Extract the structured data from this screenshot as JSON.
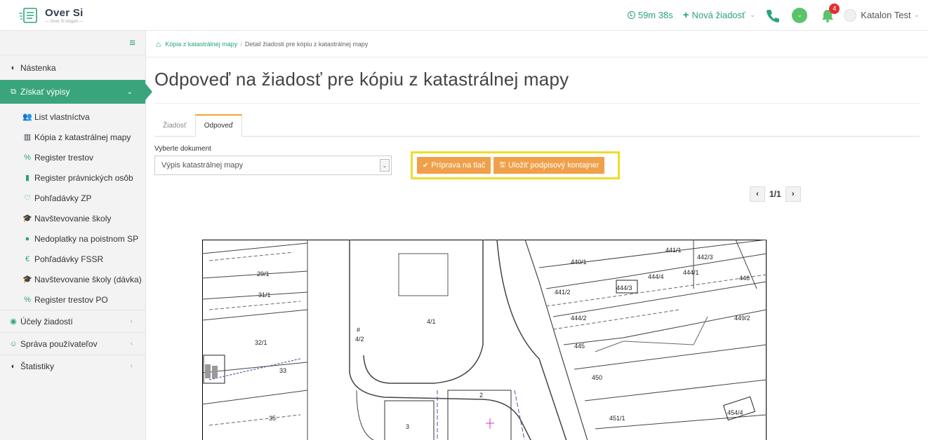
{
  "brand": {
    "name": "Over Si",
    "tagline": "— Over Si slogan —"
  },
  "topbar": {
    "timer": "59m 38s",
    "new_request": "Nová žiadosť",
    "notifications": "4",
    "user_name": "Katalon Test"
  },
  "sidebar": {
    "items": [
      {
        "label": "Nástenka",
        "icon": "dashboard-icon"
      },
      {
        "label": "Získať výpisy",
        "icon": "copy-icon",
        "active": true
      },
      {
        "label": "List vlastníctva",
        "icon": "users-icon"
      },
      {
        "label": "Kópia z katastrálnej mapy",
        "icon": "map-icon"
      },
      {
        "label": "Register trestov",
        "icon": "link-icon"
      },
      {
        "label": "Register právnických osôb",
        "icon": "book-icon"
      },
      {
        "label": "Pohľadávky ZP",
        "icon": "stethoscope-icon"
      },
      {
        "label": "Navštevovanie školy",
        "icon": "graduation-cap-icon"
      },
      {
        "label": "Nedoplatky na poistnom SP",
        "icon": "globe-icon"
      },
      {
        "label": "Pohľadávky FSSR",
        "icon": "euro-icon"
      },
      {
        "label": "Navštevovanie školy (dávka)",
        "icon": "graduation-cap-icon"
      },
      {
        "label": "Register trestov PO",
        "icon": "link-icon"
      },
      {
        "label": "Účely žiadostí",
        "icon": "target-icon"
      },
      {
        "label": "Správa používateľov",
        "icon": "users-icon"
      },
      {
        "label": "Štatistiky",
        "icon": "dashboard-icon"
      }
    ]
  },
  "breadcrumb": {
    "link": "Kópia z katastrálnej mapy",
    "current": "Detail žiadosti pre kópiu z katastrálnej mapy"
  },
  "page": {
    "title": "Odpoveď na žiadosť pre kópiu z katastrálnej mapy",
    "tabs": [
      "Žiadosť",
      "Odpoveď"
    ],
    "active_tab": "Odpoveď",
    "select_label": "Vyberte dokument",
    "select_value": "Výpis katastrálnej mapy",
    "btn_print": "Príprava na tlač",
    "btn_save": "Uložiť podpisový kontajner",
    "pager": "1/1"
  },
  "map": {
    "parcels": [
      "29/1",
      "31/1",
      "32/1",
      "33",
      "35",
      "2",
      "4/1",
      "4/2",
      "#",
      "3",
      "440/1",
      "441/1",
      "442/3",
      "441/2",
      "444/3",
      "444/4",
      "444/1",
      "446",
      "444/2",
      "449/2",
      "445",
      "450",
      "451/1",
      "454/4"
    ]
  },
  "colors": {
    "accent": "#2aa57a",
    "button": "#f0a04b",
    "highlight": "#f0dc28",
    "badge": "#e03131"
  }
}
